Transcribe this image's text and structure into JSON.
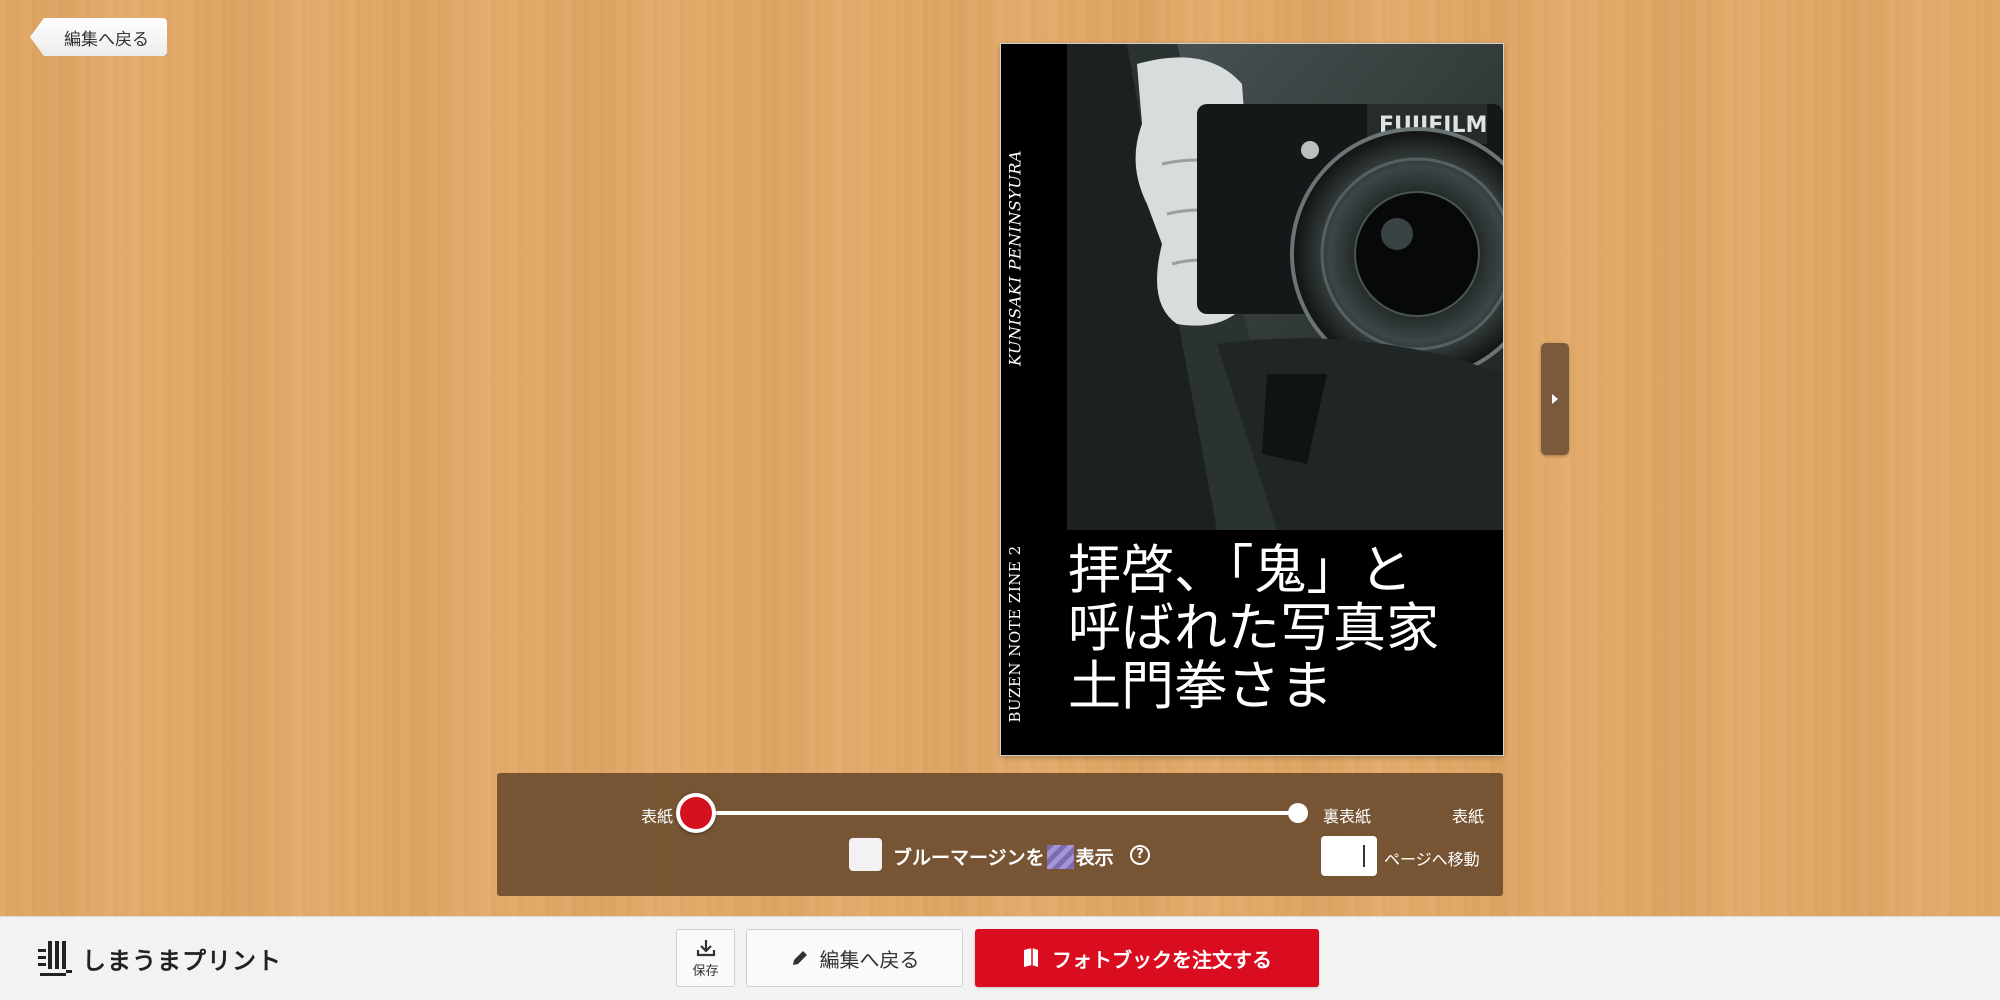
{
  "nav": {
    "back_to_edit": "編集へ戻る"
  },
  "cover": {
    "spine_top": "KUNISAKI PENINSYURA",
    "spine_bottom": "BUZEN NOTE ZINE 2",
    "title_lines": [
      "拝啓、「鬼」と",
      "呼ばれた写真家",
      "土門拳さま"
    ]
  },
  "slider": {
    "start_label": "表紙",
    "end_label": "裏表紙",
    "current_label": "表紙"
  },
  "bleed": {
    "label_prefix": "ブルーマージンを",
    "label_suffix": "表示",
    "help": "?"
  },
  "page_jump": {
    "value": "",
    "label": "ページへ移動"
  },
  "footer": {
    "brand": "しまうまプリント",
    "save_label": "保存",
    "edit_label": "編集へ戻る",
    "order_label": "フォトブックを注文する"
  },
  "colors": {
    "accent": "#d90d1f",
    "panel": "#6e4e30",
    "wood": "#e2a866",
    "margin_swatch": "#8b78c0"
  }
}
